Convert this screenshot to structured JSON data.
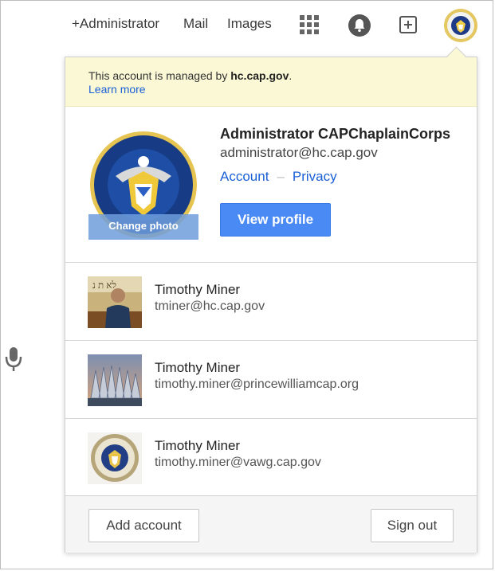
{
  "topbar": {
    "admin_link": "+Administrator",
    "mail_link": "Mail",
    "images_link": "Images",
    "icons": [
      "apps-grid-icon",
      "notifications-bell-icon",
      "share-plus-icon",
      "account-avatar"
    ]
  },
  "managed_notice": {
    "prefix": "This account is managed by ",
    "domain": "hc.cap.gov",
    "suffix": ".",
    "learn_more": "Learn more"
  },
  "current_account": {
    "name": "Administrator CAPChaplainCorps",
    "email": "administrator@hc.cap.gov",
    "account_link": "Account",
    "separator": "–",
    "privacy_link": "Privacy",
    "change_photo": "Change photo",
    "view_profile": "View profile"
  },
  "other_accounts": [
    {
      "name": "Timothy Miner",
      "email": "tminer@hc.cap.gov",
      "photo": "person-portrait"
    },
    {
      "name": "Timothy Miner",
      "email": "timothy.miner@princewilliamcap.org",
      "photo": "chapel-building"
    },
    {
      "name": "Timothy Miner",
      "email": "timothy.miner@vawg.cap.gov",
      "photo": "chaplain-seal"
    }
  ],
  "footer": {
    "add_account": "Add account",
    "sign_out": "Sign out"
  },
  "colors": {
    "accent_blue": "#4a8af4",
    "link_blue": "#1a5fd6",
    "notice_bg": "#fbf8d6"
  }
}
